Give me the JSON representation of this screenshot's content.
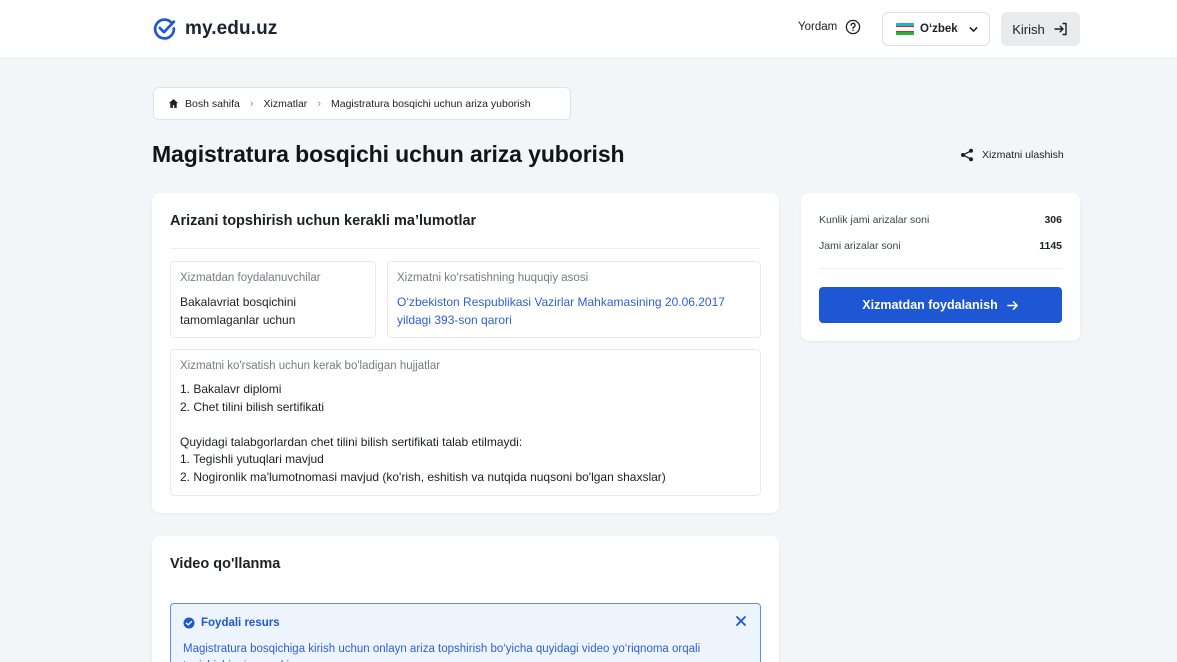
{
  "header": {
    "logo_text": "my.edu.uz",
    "help_label": "Yordam",
    "language": "O‘zbek",
    "login_label": "Kirish",
    "brand_color": "#1e57d3"
  },
  "breadcrumb": {
    "items": [
      "Bosh sahifa",
      "Xizmatlar",
      "Magistratura bosqichi uchun ariza yuborish"
    ]
  },
  "page": {
    "title": "Magistratura bosqichi uchun ariza yuborish",
    "share_label": "Xizmatni ulashish"
  },
  "info_card": {
    "title": "Arizani topshirish uchun kerakli ma’lumotlar",
    "beneficiaries": {
      "label": "Xizmatdan foydalanuvchilar",
      "value_lines": [
        "Bakalavriat bosqichini",
        "tamomlaganlar uchun"
      ]
    },
    "legal_basis": {
      "label": "Xizmatni ko‘rsatishning huquqiy asosi",
      "link_lines": [
        "O‘zbekiston Respublikasi Vazirlar Mahkamasining 20.06.2017",
        "yildagi 393-son qarori"
      ]
    },
    "documents": {
      "label": "Xizmatni ko'rsatish uchun kerak bo'ladigan hujjatlar",
      "lines": [
        "1. Bakalavr diplomi",
        "2. Chet tilini bilish sertifikati",
        "",
        "Quyidagi talabgorlardan chet tilini bilish sertifikati talab etilmaydi:",
        "1. Tegishli yutuqlari mavjud",
        "2. Nogironlik ma'lumotnomasi mavjud (ko'rish, eshitish va nutqida nuqsoni bo'lgan shaxslar)"
      ]
    }
  },
  "stats": {
    "daily_label": "Kunlik jami arizalar soni",
    "daily_value": "306",
    "total_label": "Jami arizalar soni",
    "total_value": "1145",
    "use_button": "Xizmatdan foydalanish"
  },
  "video": {
    "title": "Video qo'llanma",
    "alert_title": "Foydali resurs",
    "alert_text": "Magistratura bosqichiga kirish uchun onlayn ariza topshirish bo‘yicha quyidagi video yo‘riqnoma orqali tanishishingiz mumkin"
  }
}
